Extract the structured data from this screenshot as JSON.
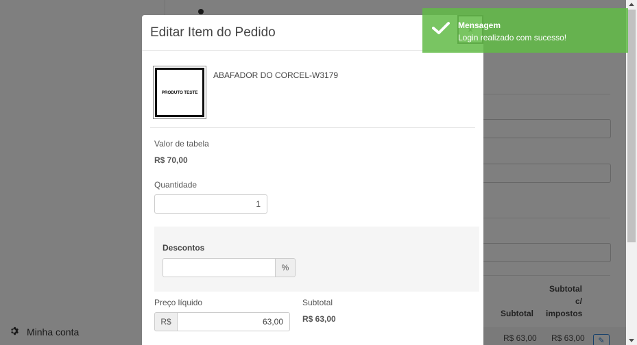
{
  "sidebar": {
    "account_label": "Minha conta",
    "account_icon": "gear-icon"
  },
  "background": {
    "table_headers": {
      "subtotal": "Subtotal",
      "subtotal_taxes_1": "Subtotal",
      "subtotal_taxes_2": "c/",
      "subtotal_taxes_3": "impostos"
    },
    "row": {
      "subtotal": "R$ 63,00",
      "subtotal_taxes": "R$ 63,00"
    }
  },
  "modal": {
    "title": "Editar Item do Pedido",
    "close_label": "×",
    "product_image_text": "PRODUTO TESTE",
    "product_name": "ABAFADOR DO CORCEL-W3179",
    "table_price_label": "Valor de tabela",
    "table_price_value": "R$ 70,00",
    "quantity_label": "Quantidade",
    "quantity_value": "1",
    "discounts_label": "Descontos",
    "discount_value": "",
    "discount_addon": "%",
    "net_price_label": "Preço líquido",
    "net_price_prefix": "R$",
    "net_price_value": "63,00",
    "subtotal_label": "Subtotal",
    "subtotal_value": "R$ 63,00"
  },
  "toast": {
    "title": "Mensagem",
    "message": "Login realizado com sucesso!",
    "color": "#62bb46"
  }
}
